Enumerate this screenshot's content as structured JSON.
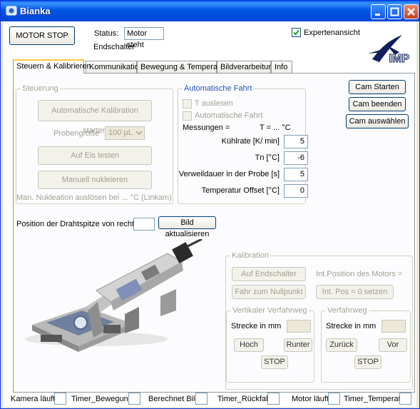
{
  "window": {
    "title": "Bianka"
  },
  "header": {
    "motor_stop_label": "MOTOR STOP",
    "status_label": "Status:",
    "status_value": "Motor steht",
    "endschalter_label": "Endschalter",
    "expert_label": "Expertenansicht",
    "expert_checked": true,
    "logo_text": "IMP"
  },
  "tabs": [
    "Steuern & Kalibrieren",
    "Kommunikation",
    "Bewegung & Temperatur",
    "Bildverarbeitung",
    "Info"
  ],
  "steuerung": {
    "caption": "Steuerung",
    "calib_button": "Automatische Kalibration starten",
    "probe_label": "Probengröße",
    "probe_value": "100 µL",
    "eis_button": "Auf Eis testen",
    "nukleieren_button": "Manuell nukleieren",
    "nucleation_text": "Man. Nukleation auslösen bei ... °C (Linkam)"
  },
  "auto": {
    "caption": "Automatische Fahrt",
    "t_auslesen": "T auslesen",
    "auto_fahrt": "Automatische Fahrt",
    "messungen": "Messungen =",
    "t_readout": "T = ... °C",
    "fields": [
      {
        "label": "Kühlrate [K/ min]",
        "value": "5"
      },
      {
        "label": "Tn [°C]",
        "value": "-6"
      },
      {
        "label": "Verweildauer in der Probe [s]",
        "value": "5"
      },
      {
        "label": "Temperatur Offset [°C]",
        "value": "0"
      }
    ]
  },
  "cam": {
    "start": "Cam Starten",
    "stop": "Cam beenden",
    "select": "Cam auswählen"
  },
  "drahtspitze": {
    "label": "Position der Drahtspitze von rechts",
    "value": "",
    "button": "Bild aktualisieren"
  },
  "kalibration": {
    "caption": "Kalibration",
    "endschalter_button": "Auf Endschalter",
    "int_position": "Int.Position des Motors =",
    "nullpunkt_button": "Fahr zum Nullpunkt",
    "int_pos_button": "Int. Pos = 0 setzen",
    "vertikal": {
      "caption": "Vertikaler Verfahrweg",
      "strecke": "Strecke in mm",
      "hoch": "Hoch",
      "runter": "Runter",
      "stop": "STOP"
    },
    "verfahrweg": {
      "caption": "Verfahrweg",
      "strecke": "Strecke in mm",
      "zurueck": "Zurück",
      "vor": "Vor",
      "stop": "STOP"
    }
  },
  "statusbar": [
    "Kamera läuft",
    "Timer_Bewegung",
    "Berechnet Bild",
    "Timer_Rückfahrt",
    "Motor läuft",
    "Timer_Temperatur"
  ],
  "colors": {
    "titlebar": "#0055e5",
    "tab_highlight": "#ffc83c",
    "group_caption_blue": "#1f4fb3"
  }
}
